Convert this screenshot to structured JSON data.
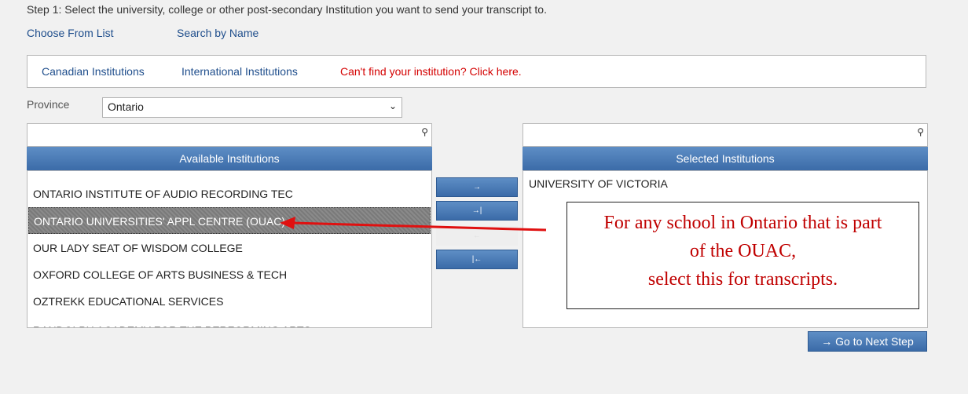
{
  "step_instruction": "Step 1: Select the university, college or other post-secondary Institution you want to send your transcript to.",
  "mode_links": {
    "choose_from_list": "Choose From List",
    "search_by_name": "Search by Name"
  },
  "tabs": {
    "canadian": "Canadian Institutions",
    "international": "International Institutions",
    "cant_find": "Can't find your institution? Click here."
  },
  "province": {
    "label": "Province",
    "selected": "Ontario"
  },
  "available": {
    "header": "Available Institutions",
    "search_value": "",
    "items": [
      "ONTARIO INSTITUTE OF AUDIO RECORDING TEC",
      "ONTARIO UNIVERSITIES' APPL CENTRE (OUAC)",
      "OUR LADY SEAT OF WISDOM COLLEGE",
      "OXFORD COLLEGE OF ARTS BUSINESS & TECH",
      "OZTREKK EDUCATIONAL SERVICES",
      "RANDOLPH ACADEMY FOR THE PERFORMING ARTS"
    ],
    "selected_index": 1
  },
  "selected": {
    "header": "Selected Institutions",
    "search_value": "",
    "items": [
      "UNIVERSITY OF VICTORIA"
    ]
  },
  "move_buttons": {
    "add": "→",
    "add_all": "→|",
    "remove": "←",
    "remove_all": "|←"
  },
  "annotation": {
    "line1": "For any school in Ontario that is part",
    "line2": "of the OUAC,",
    "line3": "select this for transcripts.",
    "color": "#c00000"
  },
  "next_button": {
    "arrow": "→",
    "label": "Go to Next Step"
  },
  "colors": {
    "link": "#1f4e8c",
    "alert": "#d40000",
    "accent": "#3b6ba8",
    "arrow": "#e01010"
  }
}
